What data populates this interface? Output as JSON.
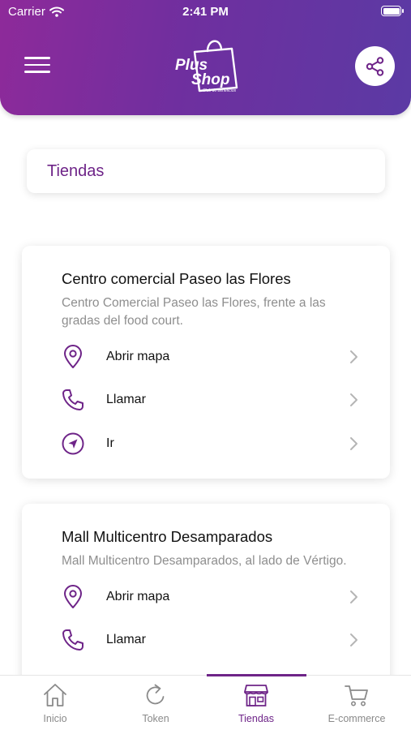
{
  "status_bar": {
    "carrier": "Carrier",
    "time": "2:41 PM"
  },
  "header": {
    "logo": {
      "line1": "Plus",
      "line2": "Shop",
      "tagline": "Club de beneficios"
    },
    "icons": {
      "menu": "hamburger-menu-icon",
      "share": "share-icon"
    }
  },
  "page_title": "Tiendas",
  "stores": [
    {
      "name": "Centro comercial Paseo las Flores",
      "description": "Centro Comercial Paseo las Flores, frente a las gradas del food court.",
      "actions": [
        {
          "label": "Abrir mapa",
          "icon": "map-pin-icon"
        },
        {
          "label": "Llamar",
          "icon": "phone-icon"
        },
        {
          "label": "Ir",
          "icon": "navigation-icon"
        }
      ]
    },
    {
      "name": "Mall Multicentro Desamparados",
      "description": "Mall Multicentro Desamparados, al lado de Vértigo.",
      "actions": [
        {
          "label": "Abrir mapa",
          "icon": "map-pin-icon"
        },
        {
          "label": "Llamar",
          "icon": "phone-icon"
        }
      ]
    }
  ],
  "tabs": [
    {
      "label": "Inicio",
      "icon": "home-icon",
      "active": false
    },
    {
      "label": "Token",
      "icon": "refresh-icon",
      "active": false
    },
    {
      "label": "Tiendas",
      "icon": "store-icon",
      "active": true
    },
    {
      "label": "E-commerce",
      "icon": "cart-icon",
      "active": false
    }
  ],
  "colors": {
    "brand_purple": "#6e2488",
    "header_gradient_start": "#8e2a9a",
    "header_gradient_end": "#5b3aa4"
  }
}
